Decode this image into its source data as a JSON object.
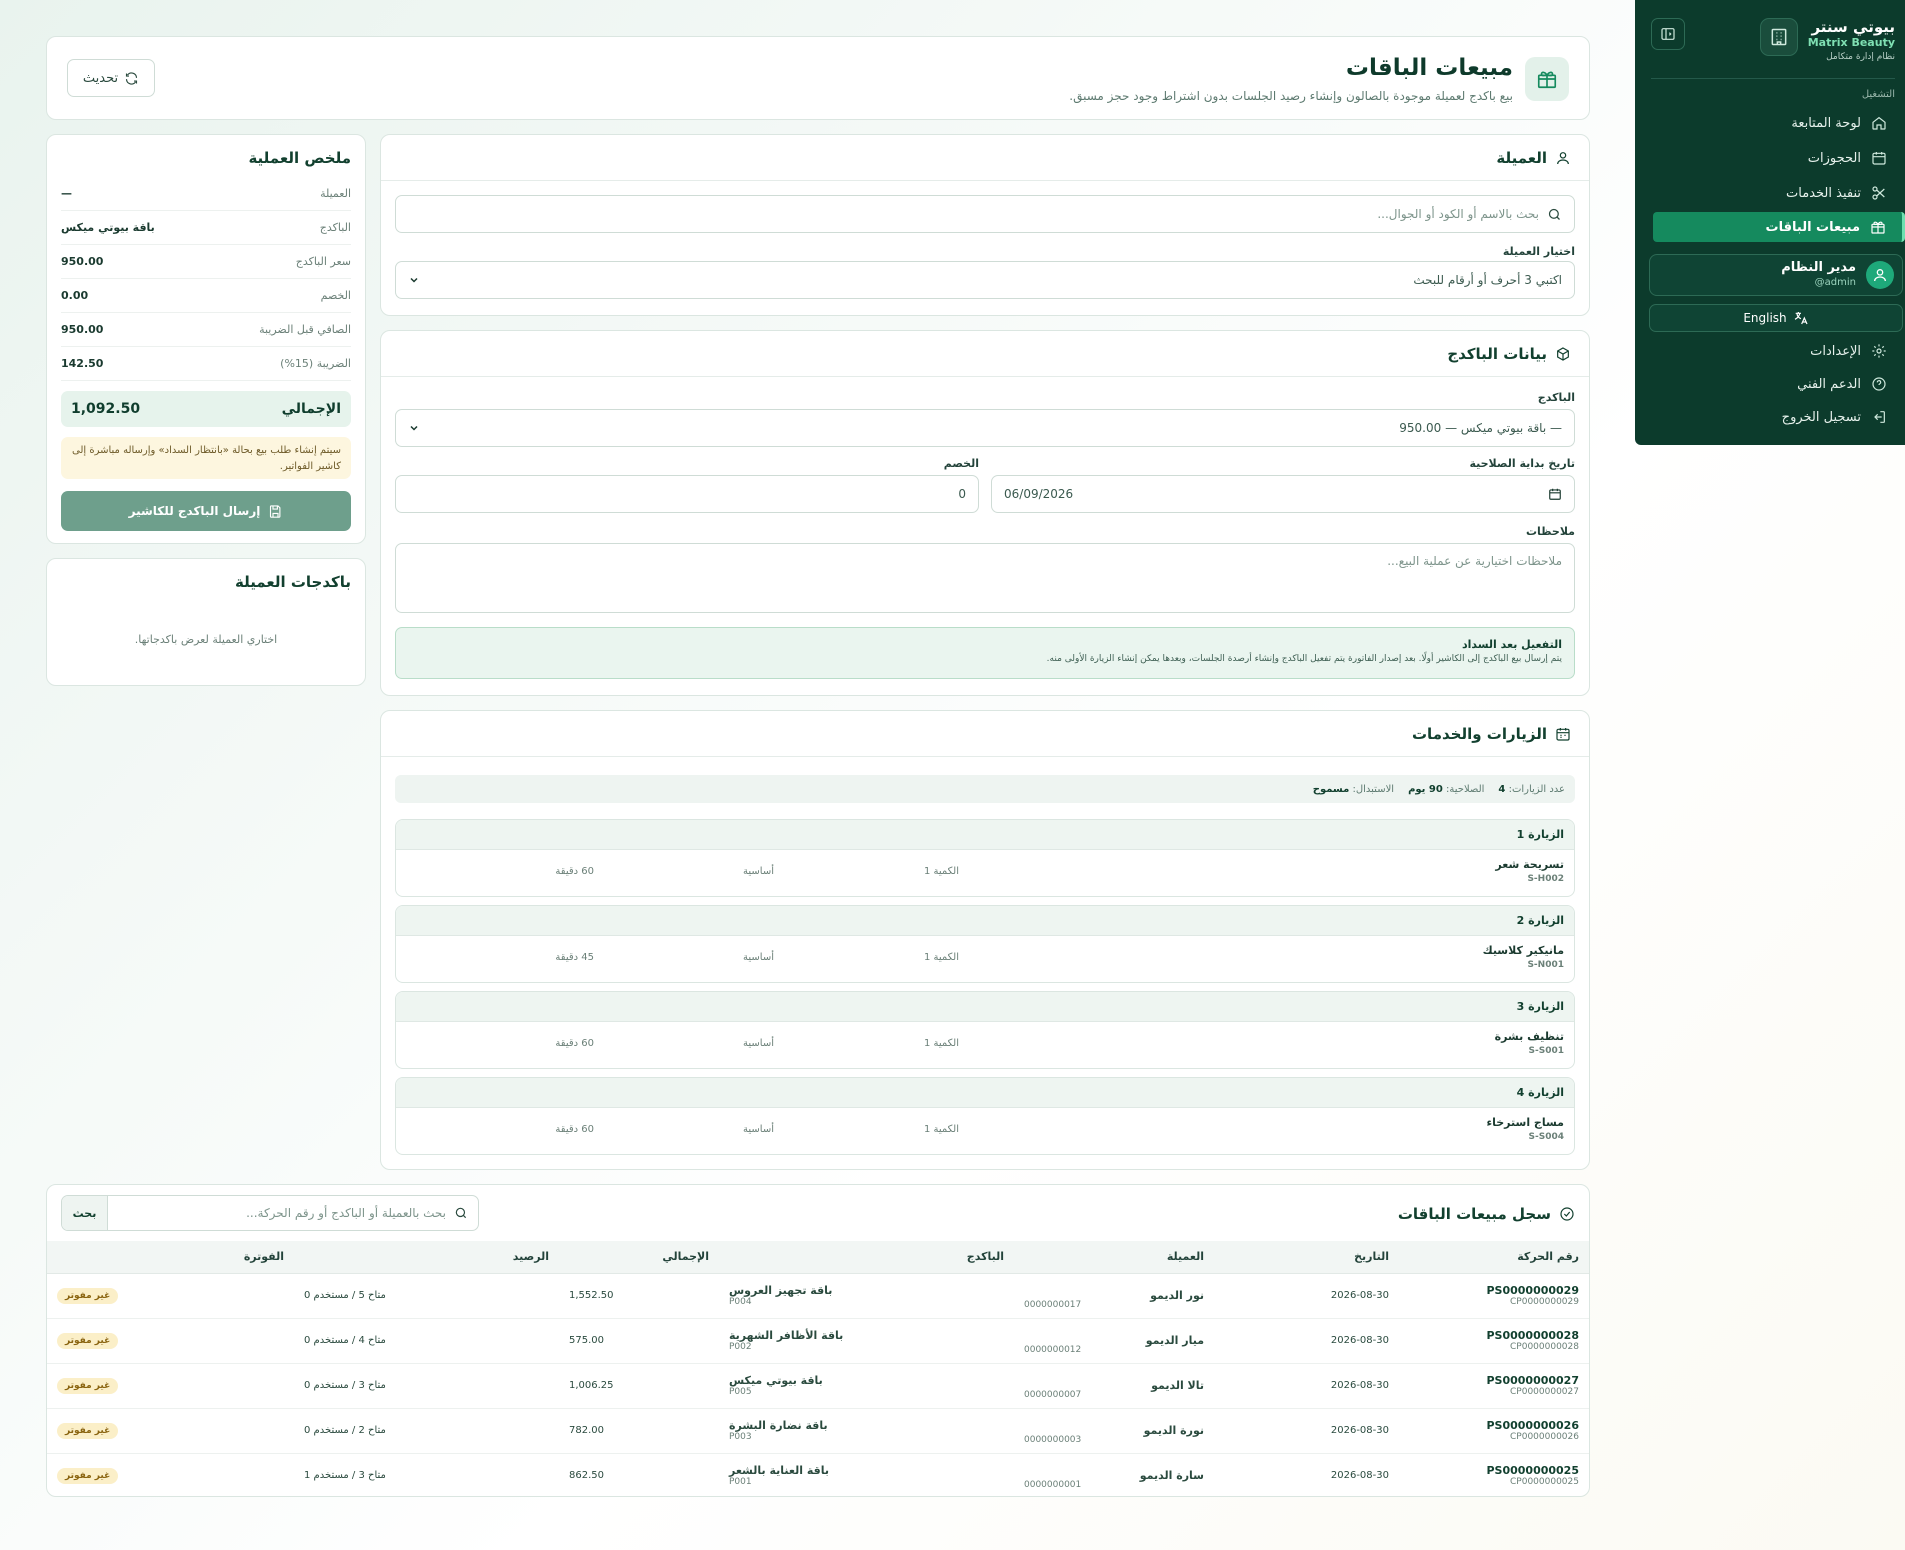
{
  "sidebar": {
    "brand_title": "بيوتي سنتر",
    "brand_subtitle": "Matrix Beauty",
    "brand_desc": "نظام إدارة متكامل",
    "section_label": "التشغيل",
    "items": [
      {
        "label": "لوحة المتابعة",
        "icon": "home-icon"
      },
      {
        "label": "الحجوزات",
        "icon": "calendar-icon"
      },
      {
        "label": "تنفيذ الخدمات",
        "icon": "scissors-icon"
      },
      {
        "label": "مبيعات الباقات",
        "icon": "gift-icon",
        "active": true
      }
    ],
    "user": {
      "name": "مدير النظام",
      "handle": "@admin"
    },
    "language_label": "English",
    "bottom_items": [
      {
        "label": "الإعدادات",
        "icon": "gear-icon"
      },
      {
        "label": "الدعم الفني",
        "icon": "help-icon"
      },
      {
        "label": "تسجيل الخروج",
        "icon": "logout-icon"
      }
    ]
  },
  "header": {
    "title": "مبيعات الباقات",
    "subtitle": "بيع باكدج لعميلة موجودة بالصالون وإنشاء رصيد الجلسات بدون اشتراط وجود حجز مسبق.",
    "refresh_label": "تحديث"
  },
  "customer": {
    "title": "العميلة",
    "search_placeholder": "بحث بالاسم أو الكود أو الجوال...",
    "select_label": "اختيار العميلة",
    "select_value": "اكتبي 3 أحرف أو أرقام للبحث"
  },
  "package": {
    "title": "بيانات الباكدج",
    "package_label": "الباكدج",
    "package_value": "— باقة بيوتي ميكس — 950.00",
    "start_date_label": "تاريخ بداية الصلاحية",
    "start_date_value": "06/09/2026",
    "discount_label": "الخصم",
    "discount_value": "0",
    "notes_label": "ملاحظات",
    "notes_placeholder": "ملاحظات اختيارية عن عملية البيع...",
    "activation_title": "التفعيل بعد السداد",
    "activation_text": "يتم إرسال بيع الباكدج إلى الكاشير أولًا. بعد إصدار الفاتورة يتم تفعيل الباكدج وإنشاء أرصدة الجلسات، وبعدها يمكن إنشاء الزيارة الأولى منه."
  },
  "visits": {
    "title": "الزيارات والخدمات",
    "count_label": "عدد الزيارات:",
    "count_value": "4",
    "validity_label": "الصلاحية:",
    "validity_value": "90 يوم",
    "replace_label": "الاستبدال:",
    "replace_value": "مسموح",
    "items": [
      {
        "header": "الزيارة 1",
        "service": "تسريحة شعر",
        "code": "S-H002",
        "qty": "الكمية 1",
        "type": "أساسية",
        "duration": "60 دقيقة"
      },
      {
        "header": "الزيارة 2",
        "service": "مانيكير كلاسيك",
        "code": "S-N001",
        "qty": "الكمية 1",
        "type": "أساسية",
        "duration": "45 دقيقة"
      },
      {
        "header": "الزيارة 3",
        "service": "تنظيف بشرة",
        "code": "S-S001",
        "qty": "الكمية 1",
        "type": "أساسية",
        "duration": "60 دقيقة"
      },
      {
        "header": "الزيارة 4",
        "service": "مساج استرخاء",
        "code": "S-S004",
        "qty": "الكمية 1",
        "type": "أساسية",
        "duration": "60 دقيقة"
      }
    ]
  },
  "summary": {
    "title": "ملخص العملية",
    "rows": [
      {
        "label": "العميلة",
        "value": "—"
      },
      {
        "label": "الباكدج",
        "value": "باقة بيوتي ميكس"
      },
      {
        "label": "سعر الباكدج",
        "value": "950.00"
      },
      {
        "label": "الخصم",
        "value": "0.00"
      },
      {
        "label": "الصافي قبل الضريبة",
        "value": "950.00"
      },
      {
        "label": "الضريبة (15%)",
        "value": "142.50"
      }
    ],
    "total_label": "الإجمالي",
    "total_value": "1,092.50",
    "notice": "سيتم إنشاء طلب بيع بحالة «بانتظار السداد» وإرساله مباشرة إلى كاشير الفواتير.",
    "submit_label": "إرسال الباكدج للكاشير"
  },
  "customer_packages": {
    "title": "باكدجات العميلة",
    "empty_text": "اختاري العميلة لعرض باكدجاتها."
  },
  "history": {
    "title": "سجل مبيعات الباقات",
    "search_placeholder": "بحث بالعميلة أو الباكدج أو رقم الحركة...",
    "search_button": "بحث",
    "columns": [
      "رقم الحركة",
      "التاريخ",
      "العميلة",
      "الباكدج",
      "الإجمالي",
      "الرصيد",
      "الفوترة"
    ],
    "rows": [
      {
        "txn": "PS0000000029",
        "txn_sub": "CP0000000029",
        "date": "2026-08-30",
        "customer": "نور الديمو",
        "customer_code": "0000000017",
        "package": "باقة تجهيز العروس",
        "package_code": "P004",
        "total": "1,552.50",
        "balance": "متاح 5 / مستخدم 0",
        "billing": "غير مفوتر"
      },
      {
        "txn": "PS0000000028",
        "txn_sub": "CP0000000028",
        "date": "2026-08-30",
        "customer": "ميار الديمو",
        "customer_code": "0000000012",
        "package": "باقة الأظافر الشهرية",
        "package_code": "P002",
        "total": "575.00",
        "balance": "متاح 4 / مستخدم 0",
        "billing": "غير مفوتر"
      },
      {
        "txn": "PS0000000027",
        "txn_sub": "CP0000000027",
        "date": "2026-08-30",
        "customer": "تالا الديمو",
        "customer_code": "0000000007",
        "package": "باقة بيوتي ميكس",
        "package_code": "P005",
        "total": "1,006.25",
        "balance": "متاح 3 / مستخدم 0",
        "billing": "غير مفوتر"
      },
      {
        "txn": "PS0000000026",
        "txn_sub": "CP0000000026",
        "date": "2026-08-30",
        "customer": "نورة الديمو",
        "customer_code": "0000000003",
        "package": "باقة نضارة البشرة",
        "package_code": "P003",
        "total": "782.00",
        "balance": "متاح 2 / مستخدم 0",
        "billing": "غير مفوتر"
      },
      {
        "txn": "PS0000000025",
        "txn_sub": "CP0000000025",
        "date": "2026-08-30",
        "customer": "سارة الديمو",
        "customer_code": "0000000001",
        "package": "باقة العناية بالشعر",
        "package_code": "P001",
        "total": "862.50",
        "balance": "متاح 3 / مستخدم 1",
        "billing": "غير مفوتر"
      }
    ]
  },
  "colors": {
    "primary": "#0c3b2c",
    "accent": "#158a5e",
    "button": "#6e9f8c",
    "warning_bg": "#fdf6df"
  }
}
